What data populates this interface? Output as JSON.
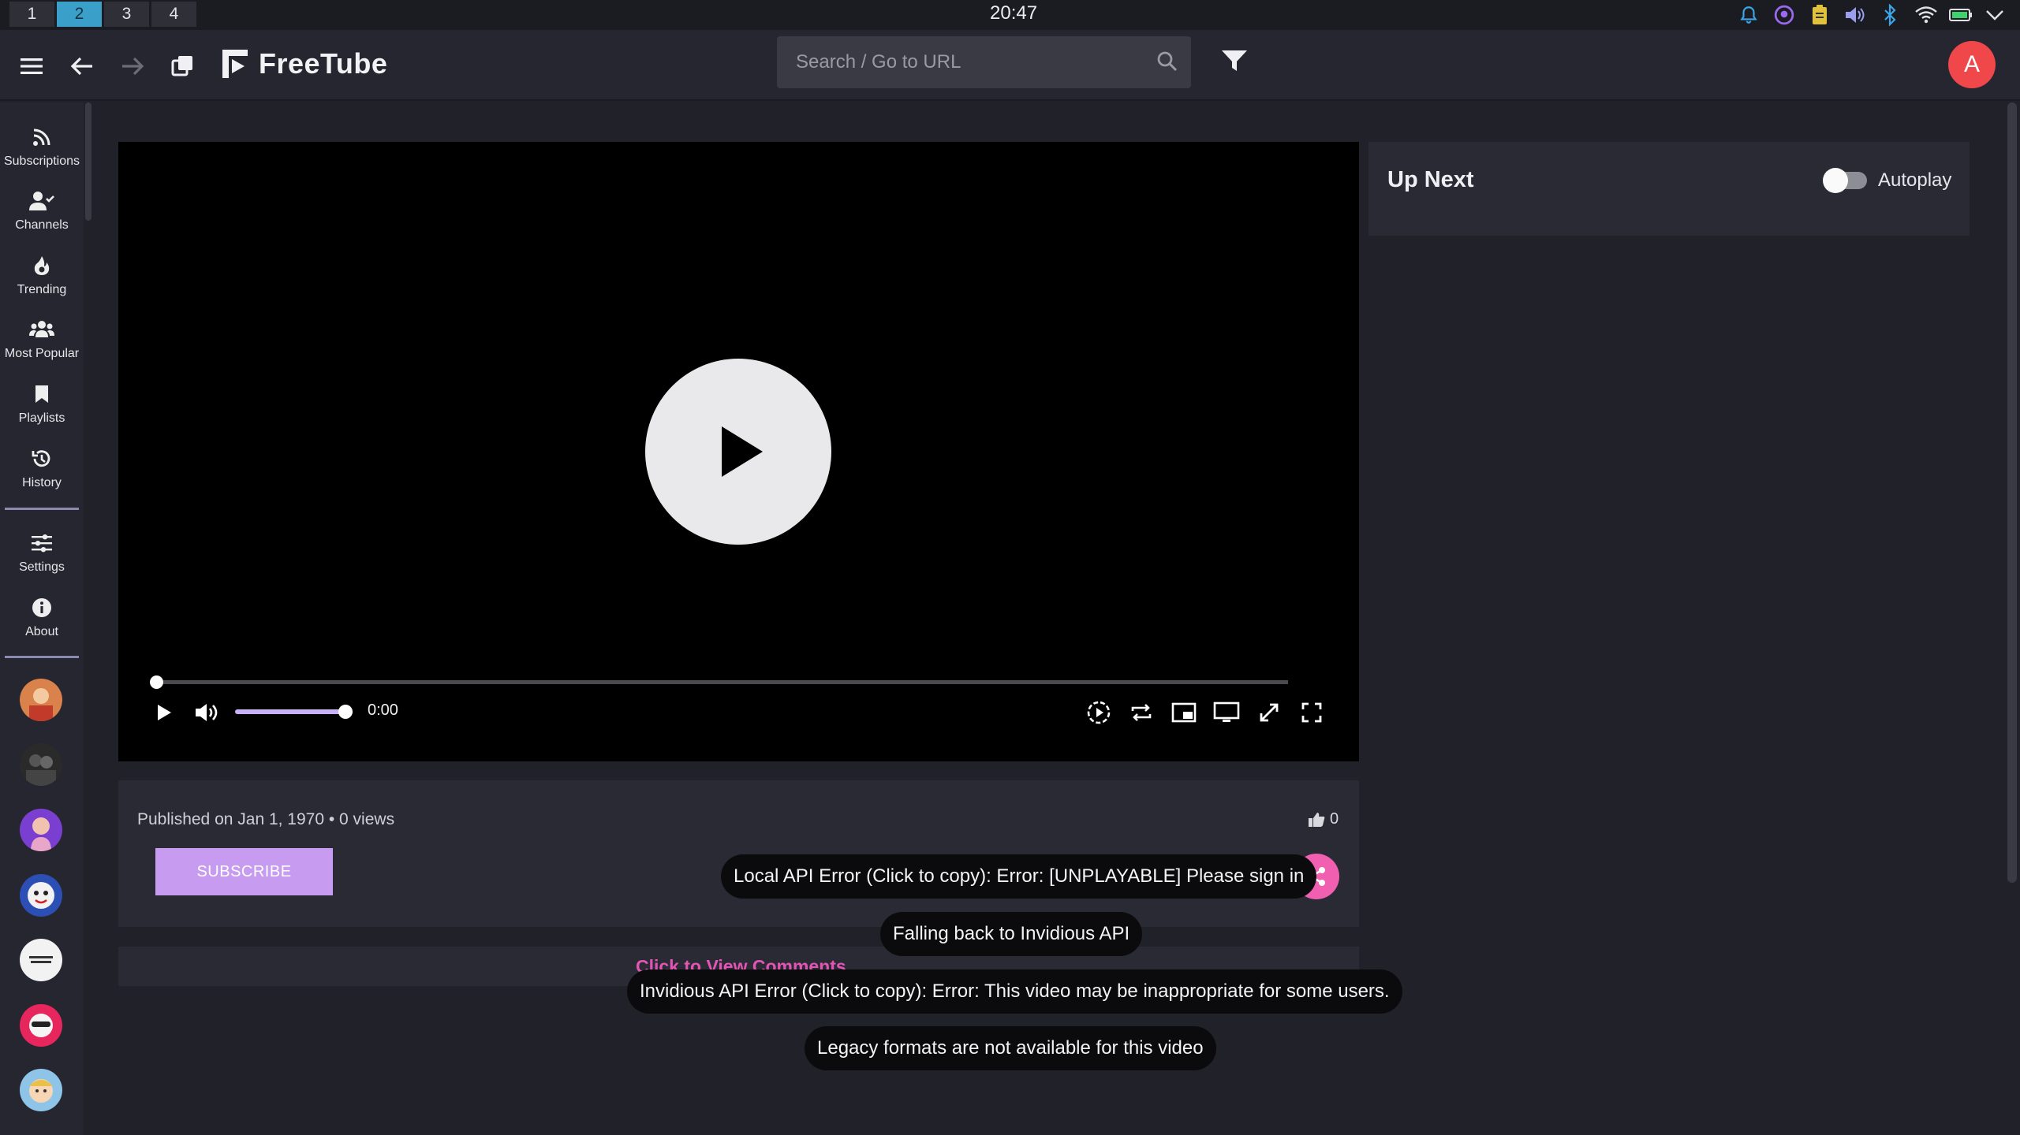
{
  "os": {
    "workspaces": [
      "1",
      "2",
      "3",
      "4"
    ],
    "active_workspace": "2",
    "clock": "20:47"
  },
  "topnav": {
    "logo_text": "FreeTube",
    "search_placeholder": "Search / Go to URL",
    "profile_initial": "A"
  },
  "sidebar": {
    "items": [
      {
        "label": "Subscriptions",
        "icon": "rss-icon"
      },
      {
        "label": "Channels",
        "icon": "user-check-icon"
      },
      {
        "label": "Trending",
        "icon": "fire-icon"
      },
      {
        "label": "Most Popular",
        "icon": "users-icon"
      },
      {
        "label": "Playlists",
        "icon": "bookmark-icon"
      },
      {
        "label": "History",
        "icon": "history-icon"
      }
    ],
    "bottom_items": [
      {
        "label": "Settings",
        "icon": "sliders-icon"
      },
      {
        "label": "About",
        "icon": "info-icon"
      }
    ]
  },
  "player": {
    "time": "0:00",
    "volume": 1.0,
    "progress": 0.0
  },
  "video": {
    "published": "Published on Jan 1, 1970 • 0 views",
    "subscribe_label": "SUBSCRIBE",
    "likes": "0",
    "comments_link": "Click to View Comments"
  },
  "upnext": {
    "title": "Up Next",
    "autoplay_label": "Autoplay",
    "autoplay_on": false
  },
  "toasts": [
    "Local API Error (Click to copy): Error: [UNPLAYABLE] Please sign in",
    "Falling back to Invidious API",
    "Invidious API Error (Click to copy): Error: This video may be inappropriate for some users.",
    "Legacy formats are not available for this video"
  ],
  "colors": {
    "accent": "#c79cf0",
    "share": "#f160b0",
    "avatar": "#f0474a",
    "workspace_active": "#3aa0c9"
  }
}
